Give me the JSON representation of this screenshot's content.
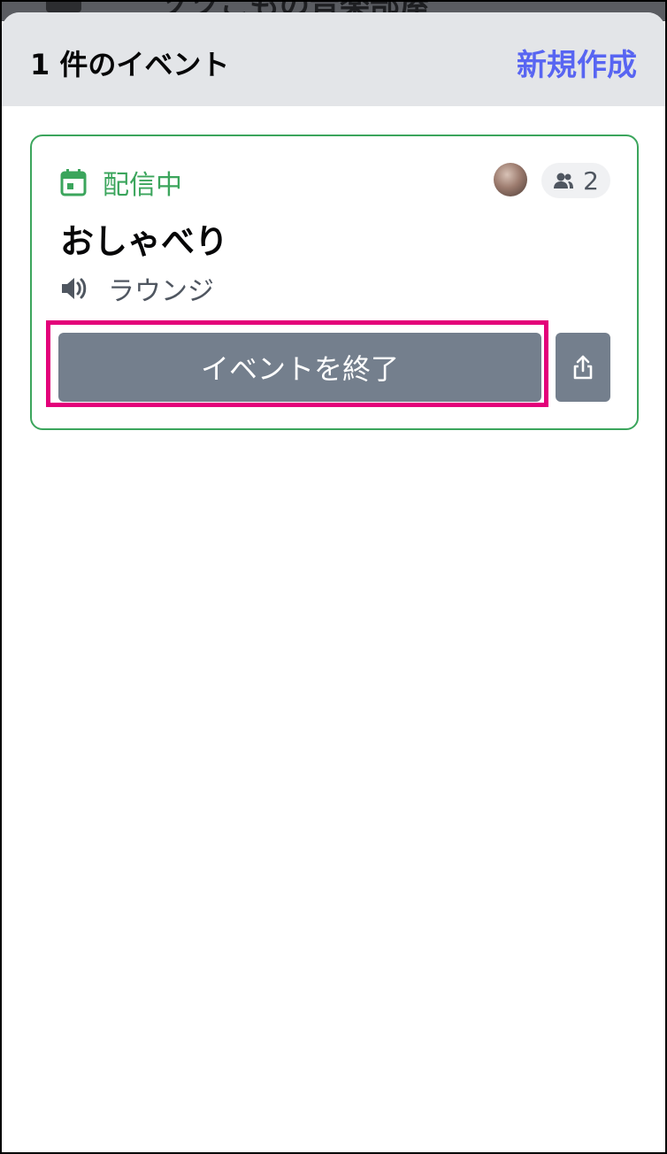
{
  "background_screen": {
    "channel_title": "ソツこもの音楽部屋"
  },
  "sheet": {
    "title": "1 件のイベント",
    "create_label": "新規作成"
  },
  "event": {
    "status": "配信中",
    "title": "おしゃべり",
    "channel": "ラウンジ",
    "participant_count": "2",
    "end_button_label": "イベントを終了",
    "icons": {
      "status": "calendar-icon",
      "participants": "people-icon",
      "channel": "speaker-icon",
      "share": "share-icon"
    }
  },
  "colors": {
    "accent": "#5865f2",
    "live_green": "#3ba55c",
    "button_gray": "#747f8d",
    "highlight_magenta": "#e3007a",
    "header_bg": "#e3e5e8"
  }
}
